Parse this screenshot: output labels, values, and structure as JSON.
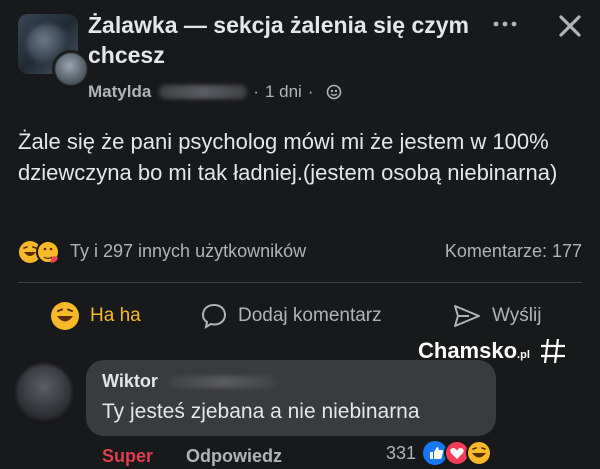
{
  "post": {
    "group_title": "Żalawka — sekcja żalenia się czym chcesz",
    "author": "Matylda",
    "time": "1 dni",
    "separator": "·",
    "body": "Żale się że pani psycholog mówi mi że jestem w 100% dziewczyna bo mi tak ładniej.(jestem osobą niebinarna)",
    "icons": {
      "more": "more-icon",
      "close": "close-icon",
      "audience": "globe-icon"
    }
  },
  "summary": {
    "reactions_text": "Ty i 297 innych użytkowników",
    "comments_text": "Komentarze: 177",
    "reaction_icons": [
      "haha-icon",
      "care-icon"
    ]
  },
  "actions": {
    "haha_label": "Ha ha",
    "comment_label": "Dodaj komentarz",
    "share_label": "Wyślij"
  },
  "watermark": {
    "text": "Chamsko",
    "suffix": ".pl"
  },
  "comment": {
    "author": "Wiktor",
    "text": "Ty jesteś zjebana a nie niebinarna",
    "super_label": "Super",
    "reply_label": "Odpowiedz",
    "reaction_count": "331",
    "reaction_icons": [
      "like-icon",
      "love-icon",
      "haha-icon"
    ]
  },
  "colors": {
    "background": "#18191a",
    "bubble": "#3a3b3c",
    "text": "#e4e6eb",
    "muted": "#b0b3b8",
    "haha": "#f7b928",
    "super": "#e03e4d",
    "like": "#1877f2",
    "love": "#f33e58"
  }
}
